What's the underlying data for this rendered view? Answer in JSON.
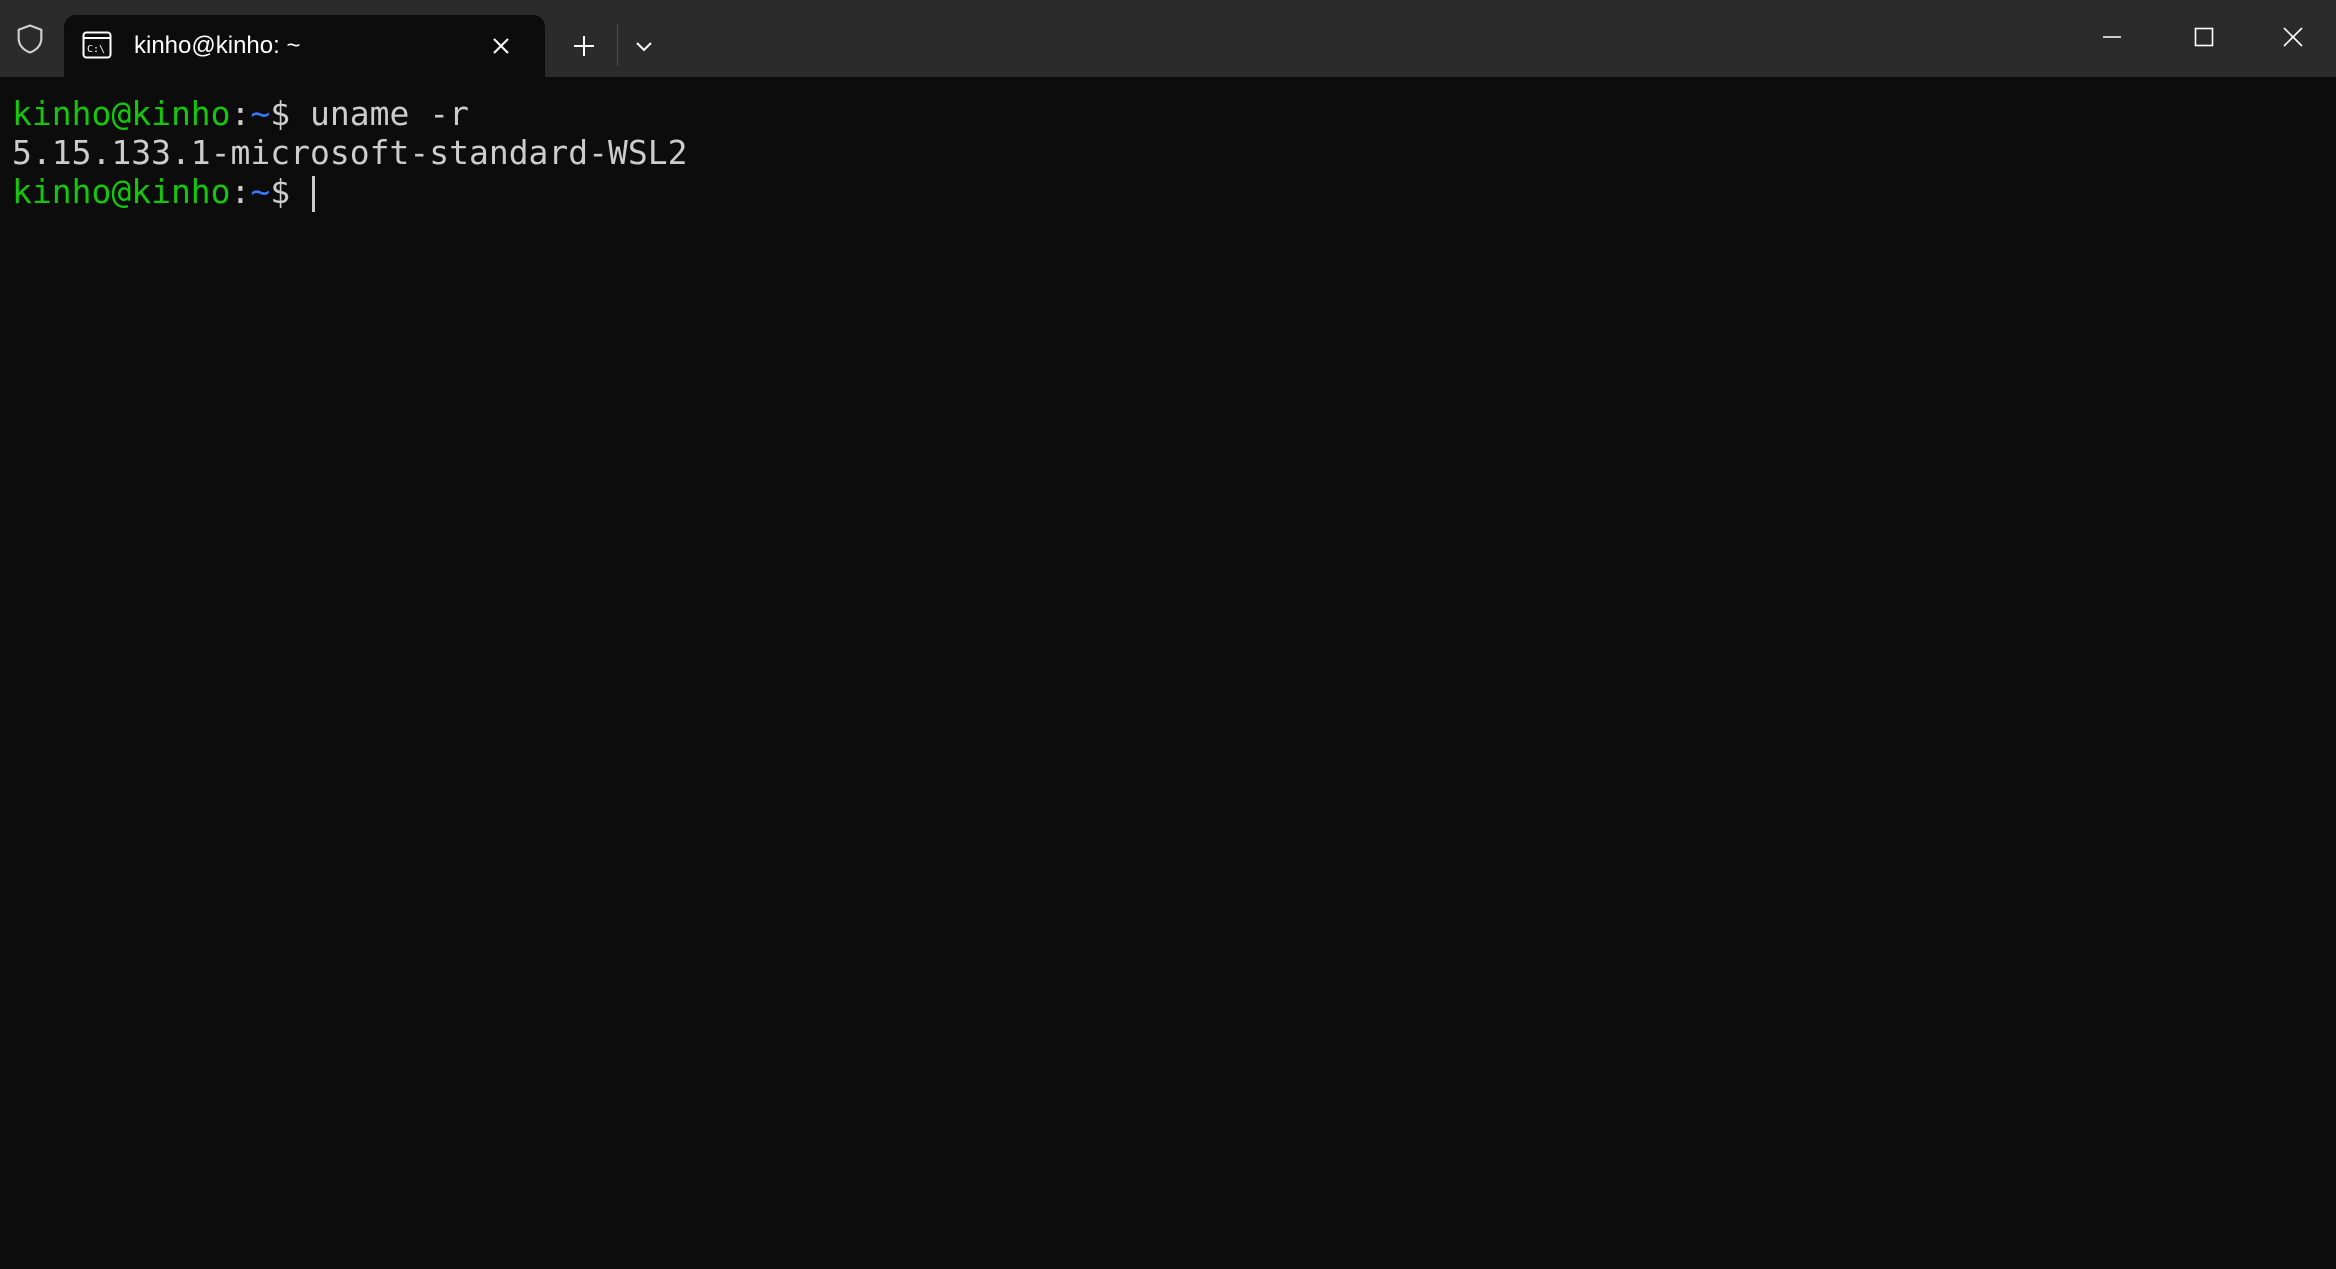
{
  "titlebar": {
    "tab_title": "kinho@kinho: ~",
    "tab_icon": "command-prompt-icon",
    "shield_icon": "shield-icon",
    "new_tab_icon": "plus-icon",
    "dropdown_icon": "chevron-down-icon",
    "window_controls": {
      "minimize_icon": "minimize-icon",
      "maximize_icon": "maximize-icon",
      "close_icon": "close-icon"
    }
  },
  "terminal": {
    "lines": [
      {
        "user_host": "kinho@kinho",
        "colon": ":",
        "path": "~",
        "dollar": "$",
        "command": " uname -r"
      },
      {
        "output": "5.15.133.1-microsoft-standard-WSL2"
      },
      {
        "user_host": "kinho@kinho",
        "colon": ":",
        "path": "~",
        "dollar": "$",
        "command": " "
      }
    ]
  },
  "colors": {
    "background": "#0c0c0c",
    "titlebar": "#2b2b2b",
    "prompt_user": "#16c60c",
    "prompt_path": "#3b78ff",
    "foreground": "#cccccc"
  }
}
